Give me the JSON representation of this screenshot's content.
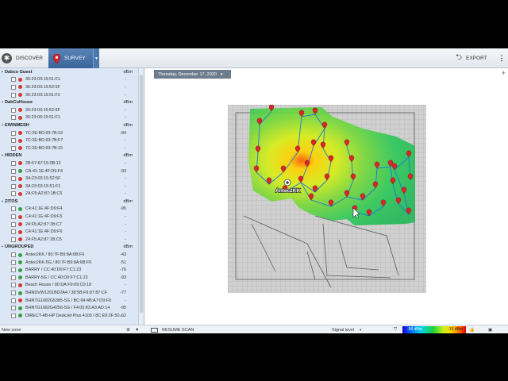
{
  "toolbar": {
    "discover_label": "DISCOVER",
    "survey_label": "SURVEY",
    "export_label": "EXPORT"
  },
  "groups": [
    {
      "name": "Dabco Guest",
      "unit": "dBm",
      "devices": [
        {
          "mac": "36:23:03:15:51:F1",
          "value": "-",
          "status": "red"
        },
        {
          "mac": "36:23:03:15:52:5F",
          "value": "-",
          "status": "red"
        },
        {
          "mac": "36:23:03:15:51:F2",
          "value": "-",
          "status": "red"
        }
      ]
    },
    {
      "name": "DabCoHouse",
      "unit": "dBm",
      "devices": [
        {
          "mac": "30:23:03:15:52:5F",
          "value": "-",
          "status": "red"
        },
        {
          "mac": "30:23:03:15:51:F1",
          "value": "-",
          "status": "red"
        }
      ]
    },
    {
      "name": "EWINMESH",
      "unit": "dBm",
      "devices": [
        {
          "mac": "7C:2E:BD:93:7B:19",
          "value": "-84",
          "status": "red"
        },
        {
          "mac": "7C:2E:BD:93:7B:F7",
          "value": "-",
          "status": "red"
        },
        {
          "mac": "7C:2E:BD:93:7B:15",
          "value": "-",
          "status": "red"
        }
      ]
    },
    {
      "name": "HIDDEN",
      "unit": "dBm",
      "devices": [
        {
          "mac": "2B:57:67:15:0B:12",
          "value": "-",
          "status": "red"
        },
        {
          "mac": "CA:41:1E:4F:D9:F4",
          "value": "-93",
          "status": "green"
        },
        {
          "mac": "3A:23:03:15:52:5F",
          "value": "-",
          "status": "red"
        },
        {
          "mac": "3A:23:03:15:51:F1",
          "value": "-",
          "status": "red"
        },
        {
          "mac": "2A:F5:A2:87:1B:C5",
          "value": "-",
          "status": "red"
        }
      ]
    },
    {
      "name": "ZITOS",
      "unit": "dBm",
      "devices": [
        {
          "mac": "C4:41:1E:4F:D9:F4",
          "value": "-95",
          "status": "green"
        },
        {
          "mac": "C4:41:1E:4F:D9:F5",
          "value": "-",
          "status": "red"
        },
        {
          "mac": "24:F5:A2:87:1B:C7",
          "value": "-",
          "status": "red"
        },
        {
          "mac": "C4:41:1E:4F:D9:F6",
          "value": "-",
          "status": "red"
        },
        {
          "mac": "24:F5:A2:87:1B:C5",
          "value": "-",
          "status": "red"
        }
      ]
    },
    {
      "name": "UNGROUPED",
      "unit": "dBm",
      "devices": [
        {
          "mac": "Antec2KK / 80:7F:B9:8A:6B:F6",
          "value": "-43",
          "status": "green"
        },
        {
          "mac": "Antec2KK-5G / 80:7F:B9:8A:6B:F5",
          "value": "-51",
          "status": "green"
        },
        {
          "mac": "BARRY / CC:40:D0:F7:C1:23",
          "value": "-76",
          "status": "green"
        },
        {
          "mac": "BARRY-5G / CC:40:D0:F7:C1:22",
          "value": "-93",
          "status": "green"
        },
        {
          "mac": "Beach House / 80:DA:F9:09:C0:18",
          "value": "-",
          "status": "red"
        },
        {
          "mac": "BHNDVW1201BD2A4 / 38:5B:F9:87:87:CF",
          "value": "-77",
          "status": "green"
        },
        {
          "mac": "BHNTG1682G5385-5G / BC:64:4B:A7:D9:F9",
          "value": "-",
          "status": "red"
        },
        {
          "mac": "BHNTG1682G4256-5G / F4:00:83:A3:AD:14",
          "value": "-95",
          "status": "green"
        },
        {
          "mac": "DIRECT-4B-HP DeskJet Plus 4100 / 8C:E9:2F:50...",
          "value": "-62",
          "status": "green"
        }
      ]
    }
  ],
  "survey": {
    "date": "Thursday, December 17, 2020",
    "ap_label": "Antec2KK"
  },
  "bottom": {
    "zone_label": "New zone",
    "resume_label": "RESUME SCAN",
    "signal_label": "Signal level",
    "legend_min": "-96 dBm",
    "legend_max": "-10 dBm"
  },
  "colors": {
    "accent": "#3a6499",
    "panel": "#dbe7f5",
    "pin": "#d8262a"
  },
  "icons": {
    "discover": "gear-icon",
    "survey": "map-pin-icon",
    "export": "export-arrow-icon",
    "zone_settings": "gear-icon",
    "resume": "scan-icon",
    "filter": "filter-icon",
    "like": "thumbs-up-icon",
    "snapshot": "camera-icon"
  }
}
